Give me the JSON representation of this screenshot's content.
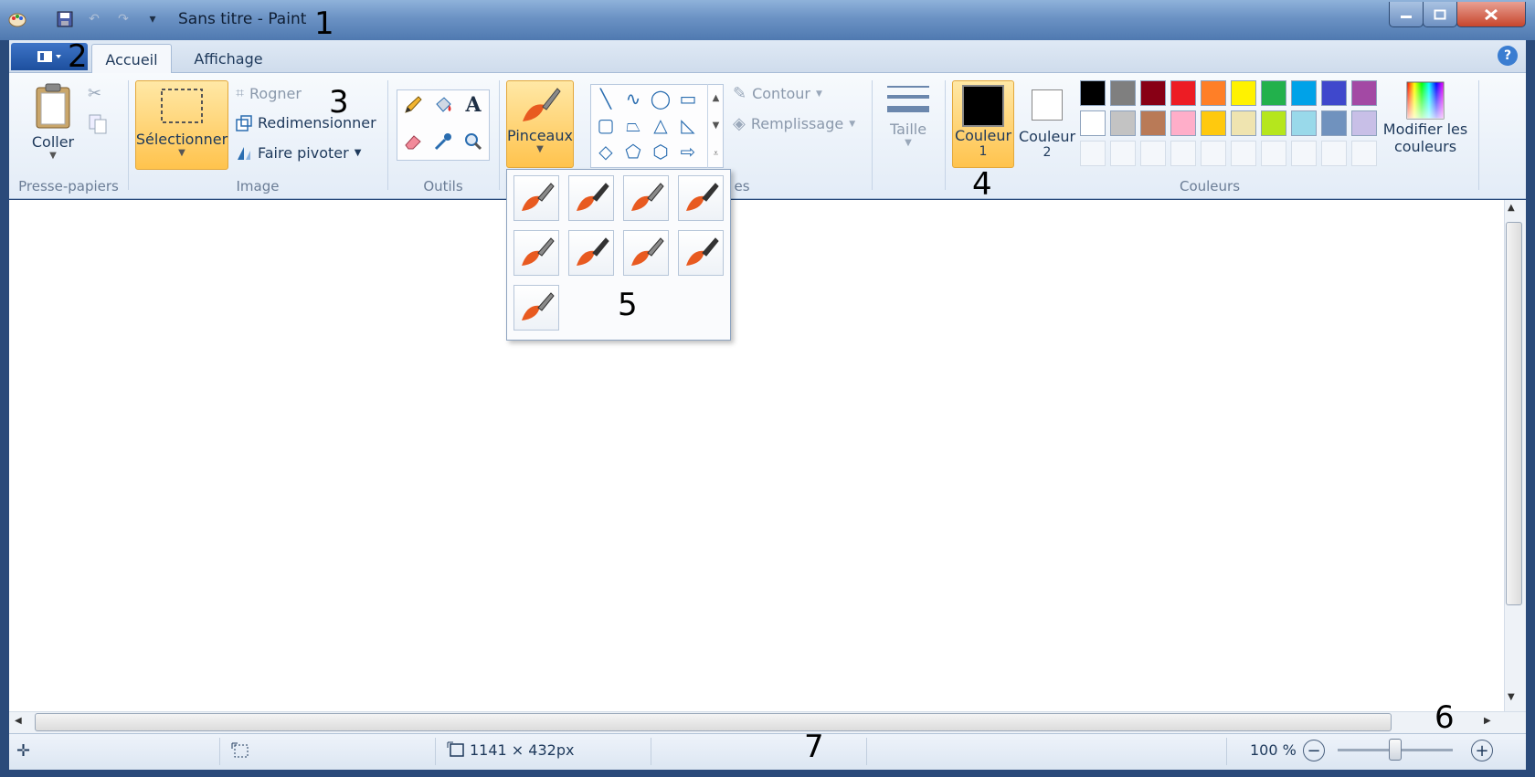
{
  "window": {
    "title": "Sans titre - Paint"
  },
  "tabs": {
    "home": "Accueil",
    "view": "Affichage"
  },
  "clipboard": {
    "paste": "Coller",
    "group": "Presse-papiers"
  },
  "image": {
    "select": "Sélectionner",
    "crop": "Rogner",
    "resize": "Redimensionner",
    "rotate": "Faire pivoter",
    "group": "Image"
  },
  "tools": {
    "group": "Outils"
  },
  "brushes": {
    "label": "Pinceaux"
  },
  "shapes": {
    "outline": "Contour",
    "fill": "Remplissage",
    "group_partial": "es"
  },
  "size": {
    "label": "Taille"
  },
  "colors": {
    "color1_line1": "Couleur",
    "color1_line2": "1",
    "color2_line1": "Couleur",
    "color2_line2": "2",
    "edit_line1": "Modifier les",
    "edit_line2": "couleurs",
    "group": "Couleurs",
    "color1_value": "#000000",
    "color2_value": "#ffffff",
    "palette_row1": [
      "#000000",
      "#7f7f7f",
      "#880015",
      "#ed1c24",
      "#ff7f27",
      "#fff200",
      "#22b14c",
      "#00a2e8",
      "#3f48cc",
      "#a349a4"
    ],
    "palette_row2": [
      "#ffffff",
      "#c3c3c3",
      "#b97a57",
      "#ffaec9",
      "#ffc90e",
      "#efe4b0",
      "#b5e61d",
      "#99d9ea",
      "#7092be",
      "#c8bfe7"
    ]
  },
  "status": {
    "canvas_size": "1141 × 432px",
    "zoom": "100 %",
    "zoom_level": 0.5
  },
  "annotations": [
    "1",
    "2",
    "3",
    "4",
    "5",
    "6",
    "7"
  ]
}
